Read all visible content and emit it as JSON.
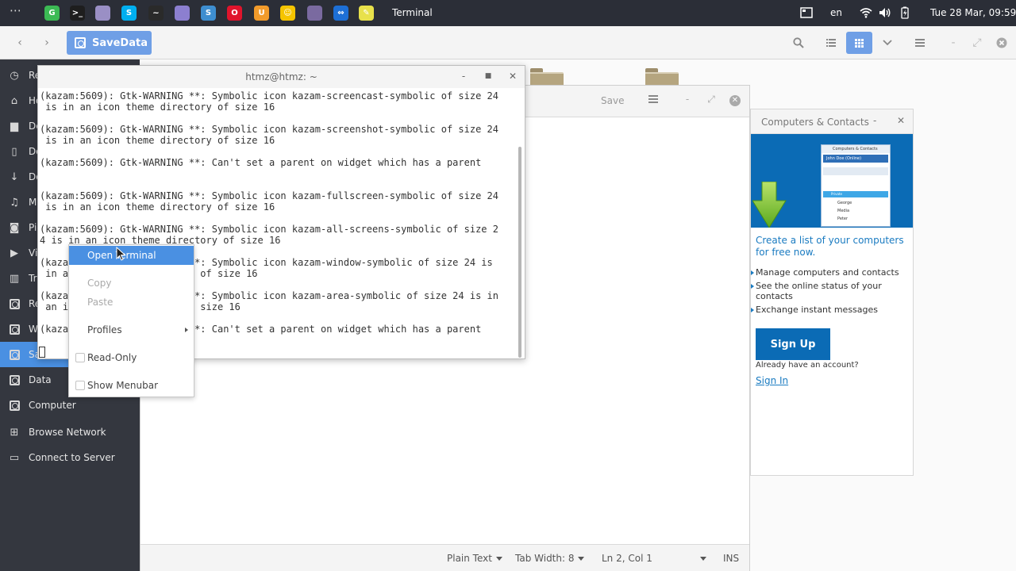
{
  "topbar": {
    "task_title": "Terminal",
    "language": "en",
    "clock": "Tue 28 Mar, 09:59",
    "launchers": [
      {
        "name": "chrome-icon",
        "color": "#3cba54",
        "glyph": "G"
      },
      {
        "name": "terminal-icon",
        "color": "#1e1e1e",
        "glyph": ">_"
      },
      {
        "name": "files-icon",
        "color": "#9a8fc5",
        "glyph": ""
      },
      {
        "name": "skype-icon",
        "color": "#00aff0",
        "glyph": "S"
      },
      {
        "name": "system-monitor-icon",
        "color": "#2a2a2a",
        "glyph": "~"
      },
      {
        "name": "text-editor-icon",
        "color": "#8c7fd0",
        "glyph": ""
      },
      {
        "name": "vpn-icon",
        "color": "#3e8ed0",
        "glyph": "S"
      },
      {
        "name": "opera-icon",
        "color": "#e0142c",
        "glyph": "O"
      },
      {
        "name": "store-icon",
        "color": "#f29b2b",
        "glyph": "U"
      },
      {
        "name": "notes-icon",
        "color": "#f5c400",
        "glyph": "☺"
      },
      {
        "name": "disk-icon",
        "color": "#7a6aa0",
        "glyph": ""
      },
      {
        "name": "teamviewer-icon",
        "color": "#1d6fd6",
        "glyph": "⇔"
      },
      {
        "name": "sticky-notes-icon",
        "color": "#e8e14b",
        "glyph": "✎"
      }
    ]
  },
  "headerbar": {
    "path_label": "SaveData"
  },
  "sidebar": {
    "items": [
      {
        "label": "Recent",
        "icon": "clock-icon"
      },
      {
        "label": "Home",
        "icon": "home-icon"
      },
      {
        "label": "Desktop",
        "icon": "folder-icon"
      },
      {
        "label": "Documents",
        "icon": "document-icon"
      },
      {
        "label": "Downloads",
        "icon": "download-icon"
      },
      {
        "label": "Music",
        "icon": "music-icon"
      },
      {
        "label": "Pictures",
        "icon": "camera-icon"
      },
      {
        "label": "Videos",
        "icon": "video-icon"
      },
      {
        "label": "Trash",
        "icon": "trash-icon"
      },
      {
        "label": "Re",
        "icon": "drive-icon"
      },
      {
        "label": "W",
        "icon": "drive-icon"
      },
      {
        "label": "Sa",
        "icon": "drive-icon"
      },
      {
        "label": "Data",
        "icon": "drive-icon"
      },
      {
        "label": "Computer",
        "icon": "drive-icon"
      },
      {
        "label": "Browse Network",
        "icon": "network-icon"
      },
      {
        "label": "Connect to Server",
        "icon": "server-icon"
      }
    ]
  },
  "gedit": {
    "save_label": "Save",
    "status": {
      "language": "Plain Text",
      "tab_width": "Tab Width: 8",
      "position": "Ln 2, Col 1",
      "mode": "INS"
    }
  },
  "contacts": {
    "title": "Computers & Contacts",
    "mini_title": "Computers & Contacts",
    "mini_user": "John Doe (Online)",
    "mini_group": "Private",
    "mini_rows": [
      "George",
      "Media",
      "Peter"
    ],
    "headline": "Create a list of your computers for free now.",
    "features": [
      "Manage computers and contacts",
      "See the online status of your contacts",
      "Exchange instant messages"
    ],
    "signup_label": "Sign Up",
    "have_account": "Already have an account?",
    "signin_label": "Sign In"
  },
  "terminal": {
    "title": "htmz@htmz: ~",
    "lines": [
      "(kazam:5609): Gtk-WARNING **: Symbolic icon kazam-screencast-symbolic of size 24",
      " is in an icon theme directory of size 16",
      "",
      "(kazam:5609): Gtk-WARNING **: Symbolic icon kazam-screenshot-symbolic of size 24",
      " is in an icon theme directory of size 16",
      "",
      "(kazam:5609): Gtk-WARNING **: Can't set a parent on widget which has a parent",
      "",
      "",
      "(kazam:5609): Gtk-WARNING **: Symbolic icon kazam-fullscreen-symbolic of size 24",
      " is in an icon theme directory of size 16",
      "",
      "(kazam:5609): Gtk-WARNING **: Symbolic icon kazam-all-screens-symbolic of size 2",
      "4 is in an icon theme directory of size 16",
      "",
      "(kazam:5609): Gtk-WARNING **: Symbolic icon kazam-window-symbolic of size 24 is",
      " in an icon theme directory of size 16",
      "",
      "(kazam:5609): Gtk-WARNING **: Symbolic icon kazam-area-symbolic of size 24 is in",
      " an icon theme directory of size 16",
      "",
      "(kazam:5609): Gtk-WARNING **: Can't set a parent on widget which has a parent"
    ]
  },
  "context_menu": {
    "open_terminal": "Open Terminal",
    "copy": "Copy",
    "paste": "Paste",
    "profiles": "Profiles",
    "read_only": "Read-Only",
    "show_menubar": "Show Menubar"
  }
}
